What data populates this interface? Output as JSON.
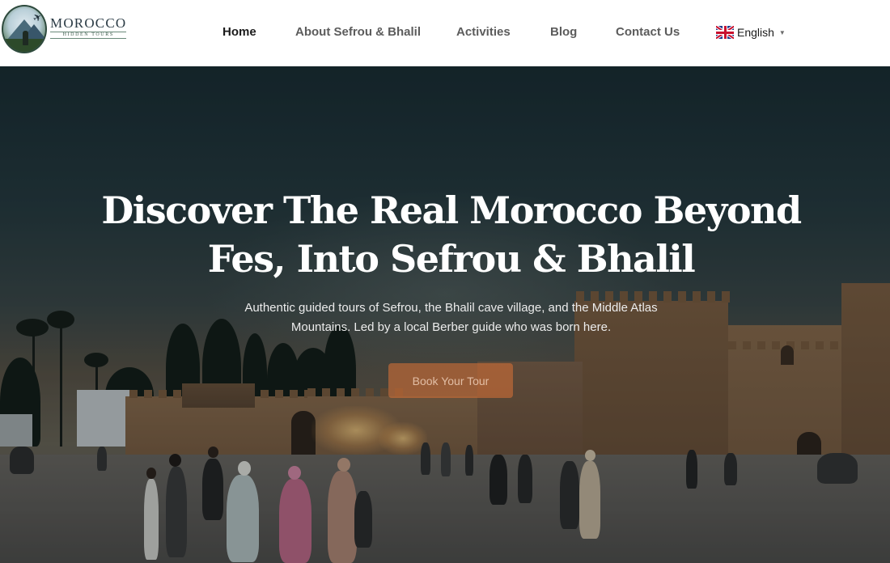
{
  "logo": {
    "title": "MOROCCO",
    "subtitle": "HIDDEN TOURS",
    "icon": "logo-badge"
  },
  "nav": {
    "items": [
      {
        "label": "Home",
        "active": true
      },
      {
        "label": "About Sefrou & Bhalil",
        "active": false
      },
      {
        "label": "Activities",
        "active": false
      },
      {
        "label": "Blog",
        "active": false
      },
      {
        "label": "Contact Us",
        "active": false
      }
    ],
    "language": {
      "label": "English",
      "flag_icon": "uk-flag-icon",
      "caret_icon": "caret-down-icon"
    }
  },
  "hero": {
    "title_line1": "Discover The Real Morocco Beyond",
    "title_line2": "Fes, Into Sefrou & Bhalil",
    "subtitle_line1": "Authentic guided tours of Sefrou, the Bhalil cave village, and the Middle Atlas",
    "subtitle_line2": "Mountains. Led by a local Berber guide who was born here.",
    "cta_label": "Book Your Tour"
  },
  "colors": {
    "nav_active": "#1b1b1b",
    "nav_inactive": "#5c5c5c",
    "cta_background": "#cd6e37",
    "hero_text": "#ffffff"
  }
}
